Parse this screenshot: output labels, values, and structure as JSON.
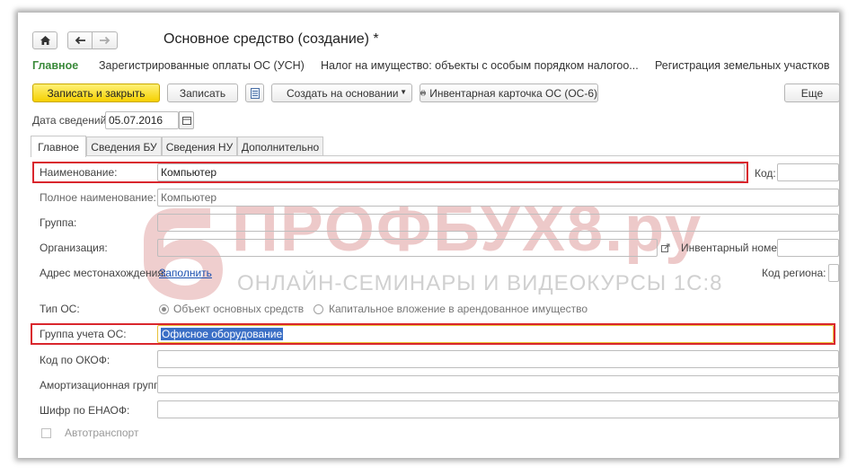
{
  "window": {
    "title": "Основное средство (создание) *"
  },
  "nav": {
    "home_icon": "home-icon",
    "back_icon": "arrow-left-icon",
    "forward_icon": "arrow-right-icon",
    "links": [
      "Главное",
      "Зарегистрированные оплаты ОС (УСН)",
      "Налог на имущество: объекты с особым порядком налогоо...",
      "Регистрация земельных участков"
    ]
  },
  "toolbar": {
    "save_close": "Записать и закрыть",
    "save": "Записать",
    "create_based": "Создать на основании",
    "inventory_card": "Инвентарная карточка ОС (ОС-6)",
    "more": "Еще"
  },
  "info_date": {
    "label": "Дата сведений:",
    "value": "05.07.2016"
  },
  "tabs": [
    "Главное",
    "Сведения БУ",
    "Сведения НУ",
    "Дополнительно"
  ],
  "form": {
    "name_label": "Наименование:",
    "name_value": "Компьютер",
    "code_label": "Код:",
    "full_name_label": "Полное наименование:",
    "full_name_value": "Компьютер",
    "group_label": "Группа:",
    "org_label": "Организация:",
    "inventory_label": "Инвентарный номер:",
    "address_label": "Адрес местонахождения:",
    "address_link": "Заполнить",
    "region_label": "Код региона:",
    "os_type_label": "Тип ОС:",
    "os_type_opt1": "Объект основных средств",
    "os_type_opt2": "Капитальное вложение в арендованное имущество",
    "account_group_label": "Группа учета ОС:",
    "account_group_value": "Офисное оборудование",
    "okof_label": "Код по ОКОФ:",
    "amort_label": "Амортизационная группа:",
    "enaof_label": "Шифр по ЕНАОФ:",
    "auto_label": "Автотранспорт"
  },
  "watermark": {
    "title": "ПРОФБУХ8.ру",
    "subtitle": "ОНЛАЙН-СЕМИНАРЫ И ВИДЕОКУРСЫ 1С:8"
  },
  "colors": {
    "accent_green": "#3a8a3a",
    "highlight_red": "#d9262d",
    "primary_yellow": "#f5d000"
  }
}
